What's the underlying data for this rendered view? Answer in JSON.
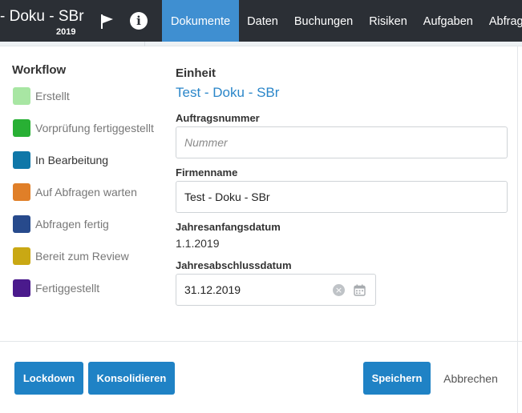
{
  "header": {
    "title": "- Doku - SBr",
    "year": "2019",
    "flag_icon": "flag-icon",
    "info_icon": "info-icon",
    "info_glyph": "i",
    "nav": [
      {
        "label": "Dokumente",
        "active": true
      },
      {
        "label": "Daten",
        "active": false
      },
      {
        "label": "Buchungen",
        "active": false
      },
      {
        "label": "Risiken",
        "active": false
      },
      {
        "label": "Aufgaben",
        "active": false
      },
      {
        "label": "Abfragen",
        "active": false
      }
    ]
  },
  "workflow": {
    "title": "Workflow",
    "items": [
      {
        "label": "Erstellt",
        "color": "#a8e6a3"
      },
      {
        "label": "Vorprüfung fertiggestellt",
        "color": "#28b034"
      },
      {
        "label": "In Bearbeitung",
        "color": "#0f77a8"
      },
      {
        "label": "Auf Abfragen warten",
        "color": "#e07f28"
      },
      {
        "label": "Abfragen fertig",
        "color": "#274a8c"
      },
      {
        "label": "Bereit zum Review",
        "color": "#c9a814"
      },
      {
        "label": "Fertiggestellt",
        "color": "#4a1a8c"
      }
    ]
  },
  "form": {
    "einheit_label": "Einheit",
    "einheit_value": "Test - Doku - SBr",
    "auftragsnummer_label": "Auftragsnummer",
    "auftragsnummer_placeholder": "Nummer",
    "auftragsnummer_value": "",
    "firmenname_label": "Firmenname",
    "firmenname_value": "Test - Doku - SBr",
    "jahresanfang_label": "Jahresanfangsdatum",
    "jahresanfang_value": "1.1.2019",
    "jahresabschluss_label": "Jahresabschlussdatum",
    "jahresabschluss_value": "31.12.2019",
    "clear_glyph": "×"
  },
  "footer": {
    "lockdown_label": "Lockdown",
    "konsolidieren_label": "Konsolidieren",
    "speichern_label": "Speichern",
    "abbrechen_label": "Abbrechen"
  },
  "colors": {
    "topbar": "#2b2f35",
    "nav_active": "#3f8fd1",
    "primary_button": "#1f82c5",
    "link_blue": "#2a86c9"
  }
}
